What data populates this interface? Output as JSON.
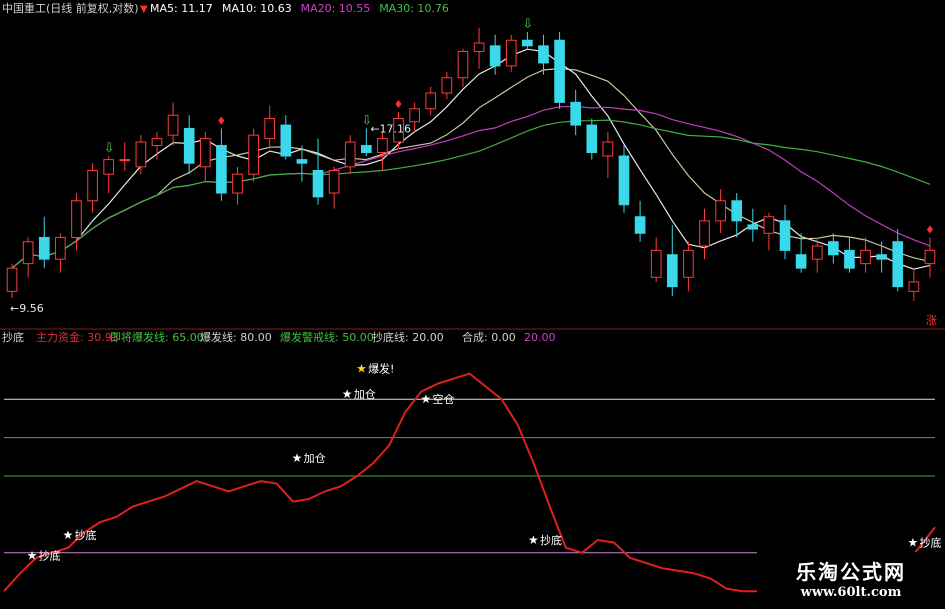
{
  "title": "中国重工(日线 前复权,对数)",
  "ma_legend": [
    {
      "label": "MA5: 11.17",
      "color": "#ffffff"
    },
    {
      "label": "MA10: 10.63",
      "color": "#ffffff"
    },
    {
      "label": "MA20: 10.55",
      "color": "#d040d0"
    },
    {
      "label": "MA30: 10.76",
      "color": "#40c040"
    }
  ],
  "indicator_legend": [
    {
      "label": "抄底",
      "color": "#d0d0d0"
    },
    {
      "label": "主力资金: 30.93",
      "color": "#e03030"
    },
    {
      "label": "即将爆发线: 65.00",
      "color": "#40c040"
    },
    {
      "label": "爆发线: 80.00",
      "color": "#d0d0d0"
    },
    {
      "label": "爆发警戒线: 50.00",
      "color": "#40c040"
    },
    {
      "label": "抄底线: 20.00",
      "color": "#d0d0d0"
    },
    {
      "label": "合成: 0.00",
      "color": "#d0d0d0"
    },
    {
      "label": "20.00",
      "color": "#d040d0"
    }
  ],
  "watermark": {
    "line1": "乐淘公式网",
    "line2": "www.60lt.com"
  },
  "chart_data": [
    {
      "type": "candlestick",
      "scale": "log",
      "ylim": [
        9.0,
        17.6
      ],
      "annotations": [
        {
          "text": "17.16",
          "kind": "high",
          "index": 22
        },
        {
          "text": "9.56",
          "kind": "low",
          "index": 0
        },
        {
          "text": "涨",
          "kind": "marker",
          "index": 57
        }
      ],
      "candles": [
        {
          "o": 9.7,
          "h": 10.3,
          "l": 9.56,
          "c": 10.2
        },
        {
          "o": 10.3,
          "h": 10.9,
          "l": 10.0,
          "c": 10.8
        },
        {
          "o": 10.9,
          "h": 11.4,
          "l": 10.2,
          "c": 10.4
        },
        {
          "o": 10.4,
          "h": 11.0,
          "l": 10.1,
          "c": 10.9
        },
        {
          "o": 10.9,
          "h": 12.0,
          "l": 10.6,
          "c": 11.8
        },
        {
          "o": 11.8,
          "h": 12.8,
          "l": 11.5,
          "c": 12.6
        },
        {
          "o": 12.5,
          "h": 13.0,
          "l": 12.0,
          "c": 12.9
        },
        {
          "o": 12.9,
          "h": 13.4,
          "l": 12.6,
          "c": 12.9
        },
        {
          "o": 12.7,
          "h": 13.6,
          "l": 12.5,
          "c": 13.4
        },
        {
          "o": 13.3,
          "h": 13.7,
          "l": 12.9,
          "c": 13.5
        },
        {
          "o": 13.6,
          "h": 14.6,
          "l": 13.3,
          "c": 14.2
        },
        {
          "o": 13.8,
          "h": 14.2,
          "l": 12.5,
          "c": 12.8
        },
        {
          "o": 12.7,
          "h": 13.7,
          "l": 12.3,
          "c": 13.5
        },
        {
          "o": 13.3,
          "h": 13.8,
          "l": 11.8,
          "c": 12.0
        },
        {
          "o": 12.0,
          "h": 12.7,
          "l": 11.7,
          "c": 12.5
        },
        {
          "o": 12.5,
          "h": 13.8,
          "l": 12.3,
          "c": 13.6
        },
        {
          "o": 13.5,
          "h": 14.5,
          "l": 13.2,
          "c": 14.1
        },
        {
          "o": 13.9,
          "h": 14.2,
          "l": 12.9,
          "c": 13.0
        },
        {
          "o": 12.9,
          "h": 13.3,
          "l": 12.3,
          "c": 12.8
        },
        {
          "o": 12.6,
          "h": 13.5,
          "l": 11.7,
          "c": 11.9
        },
        {
          "o": 12.0,
          "h": 12.7,
          "l": 11.6,
          "c": 12.6
        },
        {
          "o": 12.7,
          "h": 13.6,
          "l": 12.5,
          "c": 13.4
        },
        {
          "o": 13.3,
          "h": 13.8,
          "l": 13.0,
          "c": 13.1
        },
        {
          "o": 13.1,
          "h": 13.7,
          "l": 12.6,
          "c": 13.5
        },
        {
          "o": 13.4,
          "h": 14.3,
          "l": 13.2,
          "c": 14.1
        },
        {
          "o": 14.0,
          "h": 14.6,
          "l": 13.7,
          "c": 14.4
        },
        {
          "o": 14.4,
          "h": 15.1,
          "l": 14.2,
          "c": 14.9
        },
        {
          "o": 14.9,
          "h": 15.6,
          "l": 14.7,
          "c": 15.4
        },
        {
          "o": 15.4,
          "h": 16.4,
          "l": 15.1,
          "c": 16.3
        },
        {
          "o": 16.3,
          "h": 17.16,
          "l": 15.7,
          "c": 16.6
        },
        {
          "o": 16.5,
          "h": 16.9,
          "l": 15.5,
          "c": 15.8
        },
        {
          "o": 15.8,
          "h": 16.9,
          "l": 15.6,
          "c": 16.7
        },
        {
          "o": 16.7,
          "h": 17.0,
          "l": 16.4,
          "c": 16.5
        },
        {
          "o": 16.5,
          "h": 16.9,
          "l": 15.5,
          "c": 15.9
        },
        {
          "o": 16.7,
          "h": 17.0,
          "l": 14.4,
          "c": 14.6
        },
        {
          "o": 14.6,
          "h": 15.0,
          "l": 13.6,
          "c": 13.9
        },
        {
          "o": 13.9,
          "h": 14.1,
          "l": 12.9,
          "c": 13.1
        },
        {
          "o": 13.0,
          "h": 13.7,
          "l": 12.4,
          "c": 13.4
        },
        {
          "o": 13.0,
          "h": 13.3,
          "l": 11.5,
          "c": 11.7
        },
        {
          "o": 11.4,
          "h": 11.8,
          "l": 10.8,
          "c": 11.0
        },
        {
          "o": 10.0,
          "h": 10.9,
          "l": 9.9,
          "c": 10.6
        },
        {
          "o": 10.5,
          "h": 11.2,
          "l": 9.6,
          "c": 9.8
        },
        {
          "o": 10.0,
          "h": 10.8,
          "l": 9.7,
          "c": 10.6
        },
        {
          "o": 10.7,
          "h": 11.6,
          "l": 10.4,
          "c": 11.3
        },
        {
          "o": 11.3,
          "h": 12.1,
          "l": 11.0,
          "c": 11.8
        },
        {
          "o": 11.8,
          "h": 12.0,
          "l": 10.9,
          "c": 11.3
        },
        {
          "o": 11.2,
          "h": 11.6,
          "l": 10.8,
          "c": 11.1
        },
        {
          "o": 11.0,
          "h": 11.5,
          "l": 10.6,
          "c": 11.4
        },
        {
          "o": 11.3,
          "h": 11.7,
          "l": 10.4,
          "c": 10.6
        },
        {
          "o": 10.5,
          "h": 11.0,
          "l": 10.1,
          "c": 10.2
        },
        {
          "o": 10.4,
          "h": 10.9,
          "l": 10.1,
          "c": 10.7
        },
        {
          "o": 10.8,
          "h": 11.0,
          "l": 10.3,
          "c": 10.5
        },
        {
          "o": 10.6,
          "h": 10.9,
          "l": 10.1,
          "c": 10.2
        },
        {
          "o": 10.3,
          "h": 10.9,
          "l": 10.1,
          "c": 10.6
        },
        {
          "o": 10.5,
          "h": 10.8,
          "l": 10.1,
          "c": 10.4
        },
        {
          "o": 10.8,
          "h": 11.1,
          "l": 9.7,
          "c": 9.8
        },
        {
          "o": 9.7,
          "h": 10.2,
          "l": 9.5,
          "c": 9.9
        },
        {
          "o": 10.3,
          "h": 10.9,
          "l": 10.0,
          "c": 10.6
        }
      ],
      "signals": [
        {
          "index": 13,
          "kind": "down-red"
        },
        {
          "index": 6,
          "kind": "up-green"
        },
        {
          "index": 22,
          "kind": "up-green"
        },
        {
          "index": 32,
          "kind": "up-green"
        },
        {
          "index": 24,
          "kind": "down-red"
        },
        {
          "index": 57,
          "kind": "down-red"
        }
      ]
    },
    {
      "type": "line",
      "title": "抄底",
      "ylim": [
        0,
        100
      ],
      "hlines": [
        {
          "value": 80,
          "name": "爆发线"
        },
        {
          "value": 65,
          "name": "即将爆发线"
        },
        {
          "value": 50,
          "name": "爆发警戒线"
        },
        {
          "value": 20,
          "name": "抄底线"
        }
      ],
      "series": [
        {
          "name": "主力资金",
          "values": [
            5,
            12,
            18,
            20,
            22,
            28,
            32,
            34,
            38,
            40,
            42,
            45,
            48,
            46,
            44,
            46,
            48,
            47,
            40,
            41,
            44,
            46,
            50,
            55,
            62,
            75,
            83,
            86,
            88,
            90,
            85,
            80,
            70,
            55,
            38,
            22,
            20,
            25,
            24,
            18,
            16,
            14,
            13,
            12,
            10,
            6,
            5,
            5,
            8,
            10,
            10,
            9,
            8,
            7,
            8,
            10,
            14,
            22,
            30
          ]
        }
      ],
      "labels": [
        {
          "text": "抄底",
          "index": 4,
          "value": 19
        },
        {
          "text": "抄底",
          "index": 9,
          "value": 27
        },
        {
          "text": "加仓",
          "index": 41,
          "value": 57
        },
        {
          "text": "加仓",
          "index": 48,
          "value": 82
        },
        {
          "text": "爆发!",
          "index": 50,
          "value": 92
        },
        {
          "text": "空仓",
          "index": 59,
          "value": 80
        },
        {
          "text": "抄底",
          "index": 74,
          "value": 25
        },
        {
          "text": "抄底",
          "index": 127,
          "value": 24
        }
      ]
    }
  ]
}
